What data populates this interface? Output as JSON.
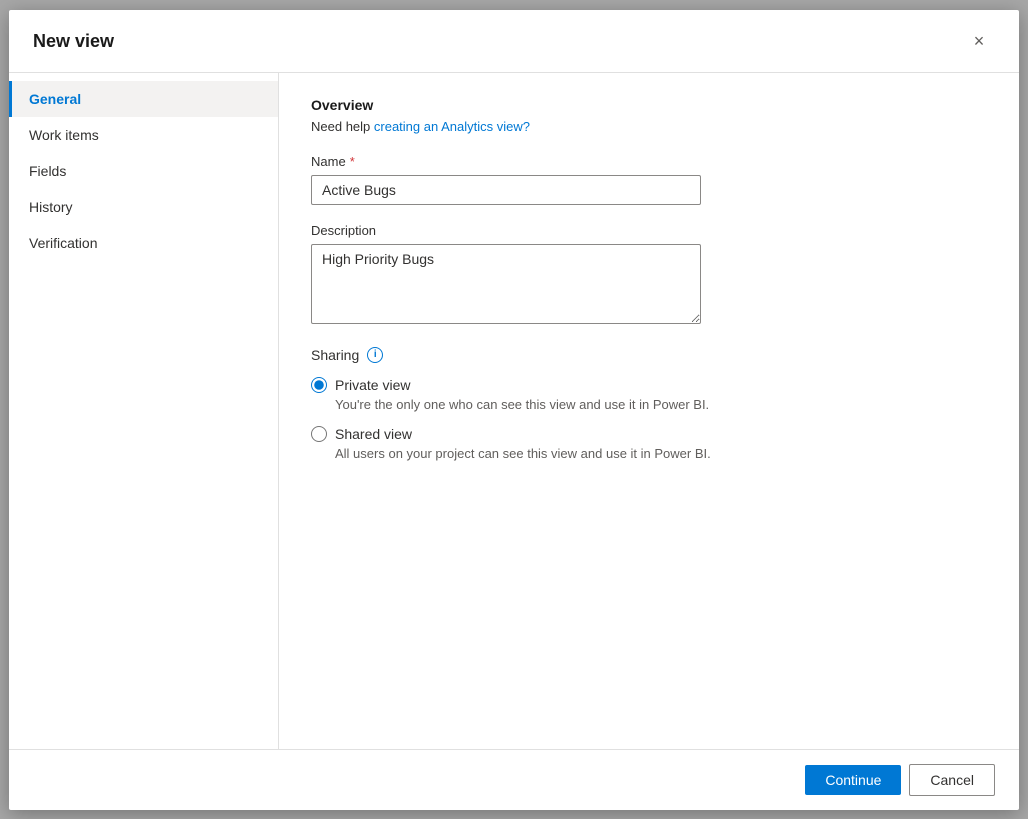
{
  "dialog": {
    "title": "New view",
    "close_label": "×"
  },
  "sidebar": {
    "items": [
      {
        "id": "general",
        "label": "General",
        "active": true
      },
      {
        "id": "work-items",
        "label": "Work items",
        "active": false
      },
      {
        "id": "fields",
        "label": "Fields",
        "active": false
      },
      {
        "id": "history",
        "label": "History",
        "active": false
      },
      {
        "id": "verification",
        "label": "Verification",
        "active": false
      }
    ]
  },
  "content": {
    "section_title": "Overview",
    "help_prefix": "Need help ",
    "help_link_text": "creating an Analytics view?",
    "name_label": "Name",
    "name_required": true,
    "name_value": "Active Bugs",
    "name_placeholder": "",
    "description_label": "Description",
    "description_value": "High Priority Bugs",
    "sharing_label": "Sharing",
    "info_icon_label": "i",
    "radio_options": [
      {
        "id": "private",
        "label": "Private view",
        "description": "You're the only one who can see this view and use it in Power BI.",
        "checked": true
      },
      {
        "id": "shared",
        "label": "Shared view",
        "description": "All users on your project can see this view and use it in Power BI.",
        "checked": false
      }
    ]
  },
  "footer": {
    "continue_label": "Continue",
    "cancel_label": "Cancel"
  }
}
